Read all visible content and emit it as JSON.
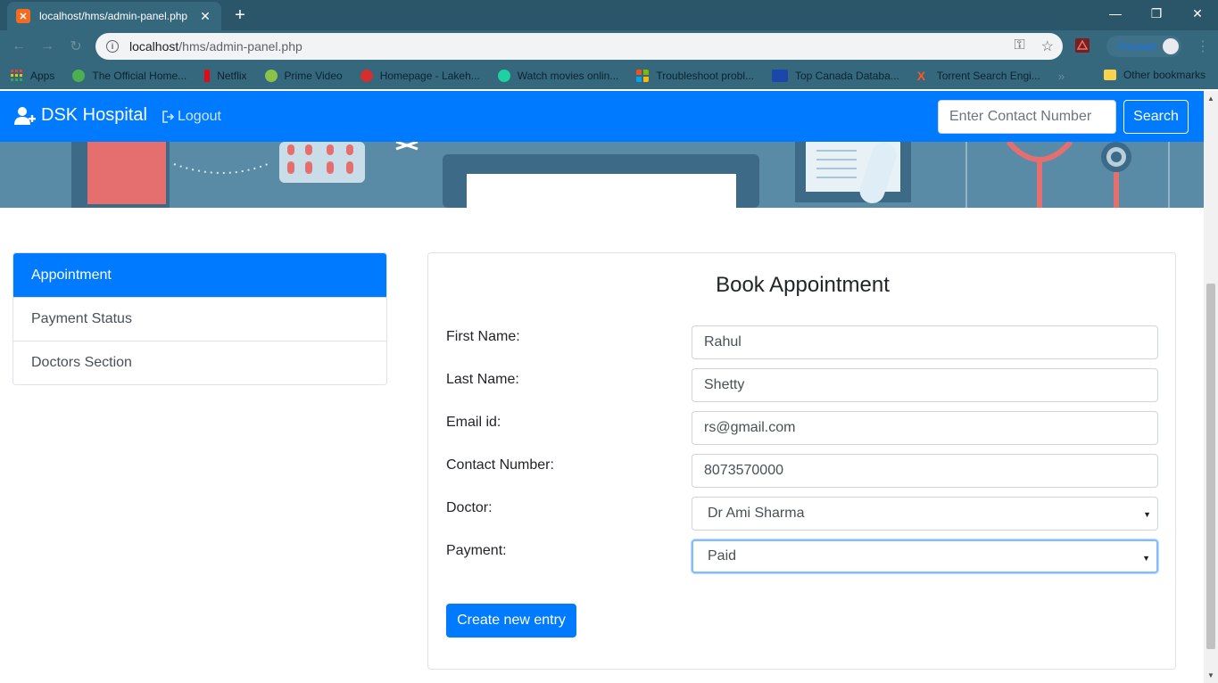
{
  "browser": {
    "tab_title": "localhost/hms/admin-panel.php",
    "url_host": "localhost",
    "url_path": "/hms/admin-panel.php",
    "profile_name": "Paused",
    "bookmarks": [
      {
        "label": "Apps",
        "color": "#4285f4"
      },
      {
        "label": "The Official Home...",
        "color": "#4caf50"
      },
      {
        "label": "Netflix",
        "color": "#e50914"
      },
      {
        "label": "Prime Video",
        "color": "#8bc34a"
      },
      {
        "label": "Homepage - Lakeh...",
        "color": "#d32f2f"
      },
      {
        "label": "Watch movies onlin...",
        "color": "#1dd1a1"
      },
      {
        "label": "Troubleshoot probl...",
        "color": "#f25022"
      },
      {
        "label": "Top Canada Databa...",
        "color": "#1a47a8"
      },
      {
        "label": "Torrent Search Engi...",
        "color": "#ff5722"
      }
    ],
    "bookmarks_more": "»",
    "other_bookmarks": "Other bookmarks"
  },
  "navbar": {
    "brand": "DSK Hospital",
    "logout": "Logout",
    "search_placeholder": "Enter Contact Number",
    "search_button": "Search"
  },
  "sidebar": {
    "items": [
      {
        "label": "Appointment",
        "active": true
      },
      {
        "label": "Payment Status",
        "active": false
      },
      {
        "label": "Doctors Section",
        "active": false
      }
    ]
  },
  "form": {
    "title": "Book Appointment",
    "fields": [
      {
        "label": "First Name:",
        "value": "Rahul"
      },
      {
        "label": "Last Name:",
        "value": "Shetty"
      },
      {
        "label": "Email id:",
        "value": "rs@gmail.com"
      },
      {
        "label": "Contact Number:",
        "value": "8073570000"
      },
      {
        "label": "Doctor:",
        "value": "Dr Ami Sharma"
      },
      {
        "label": "Payment:",
        "value": "Paid"
      }
    ],
    "submit": "Create new entry"
  },
  "colors": {
    "primary": "#007bff",
    "chrome": "#35677d"
  }
}
